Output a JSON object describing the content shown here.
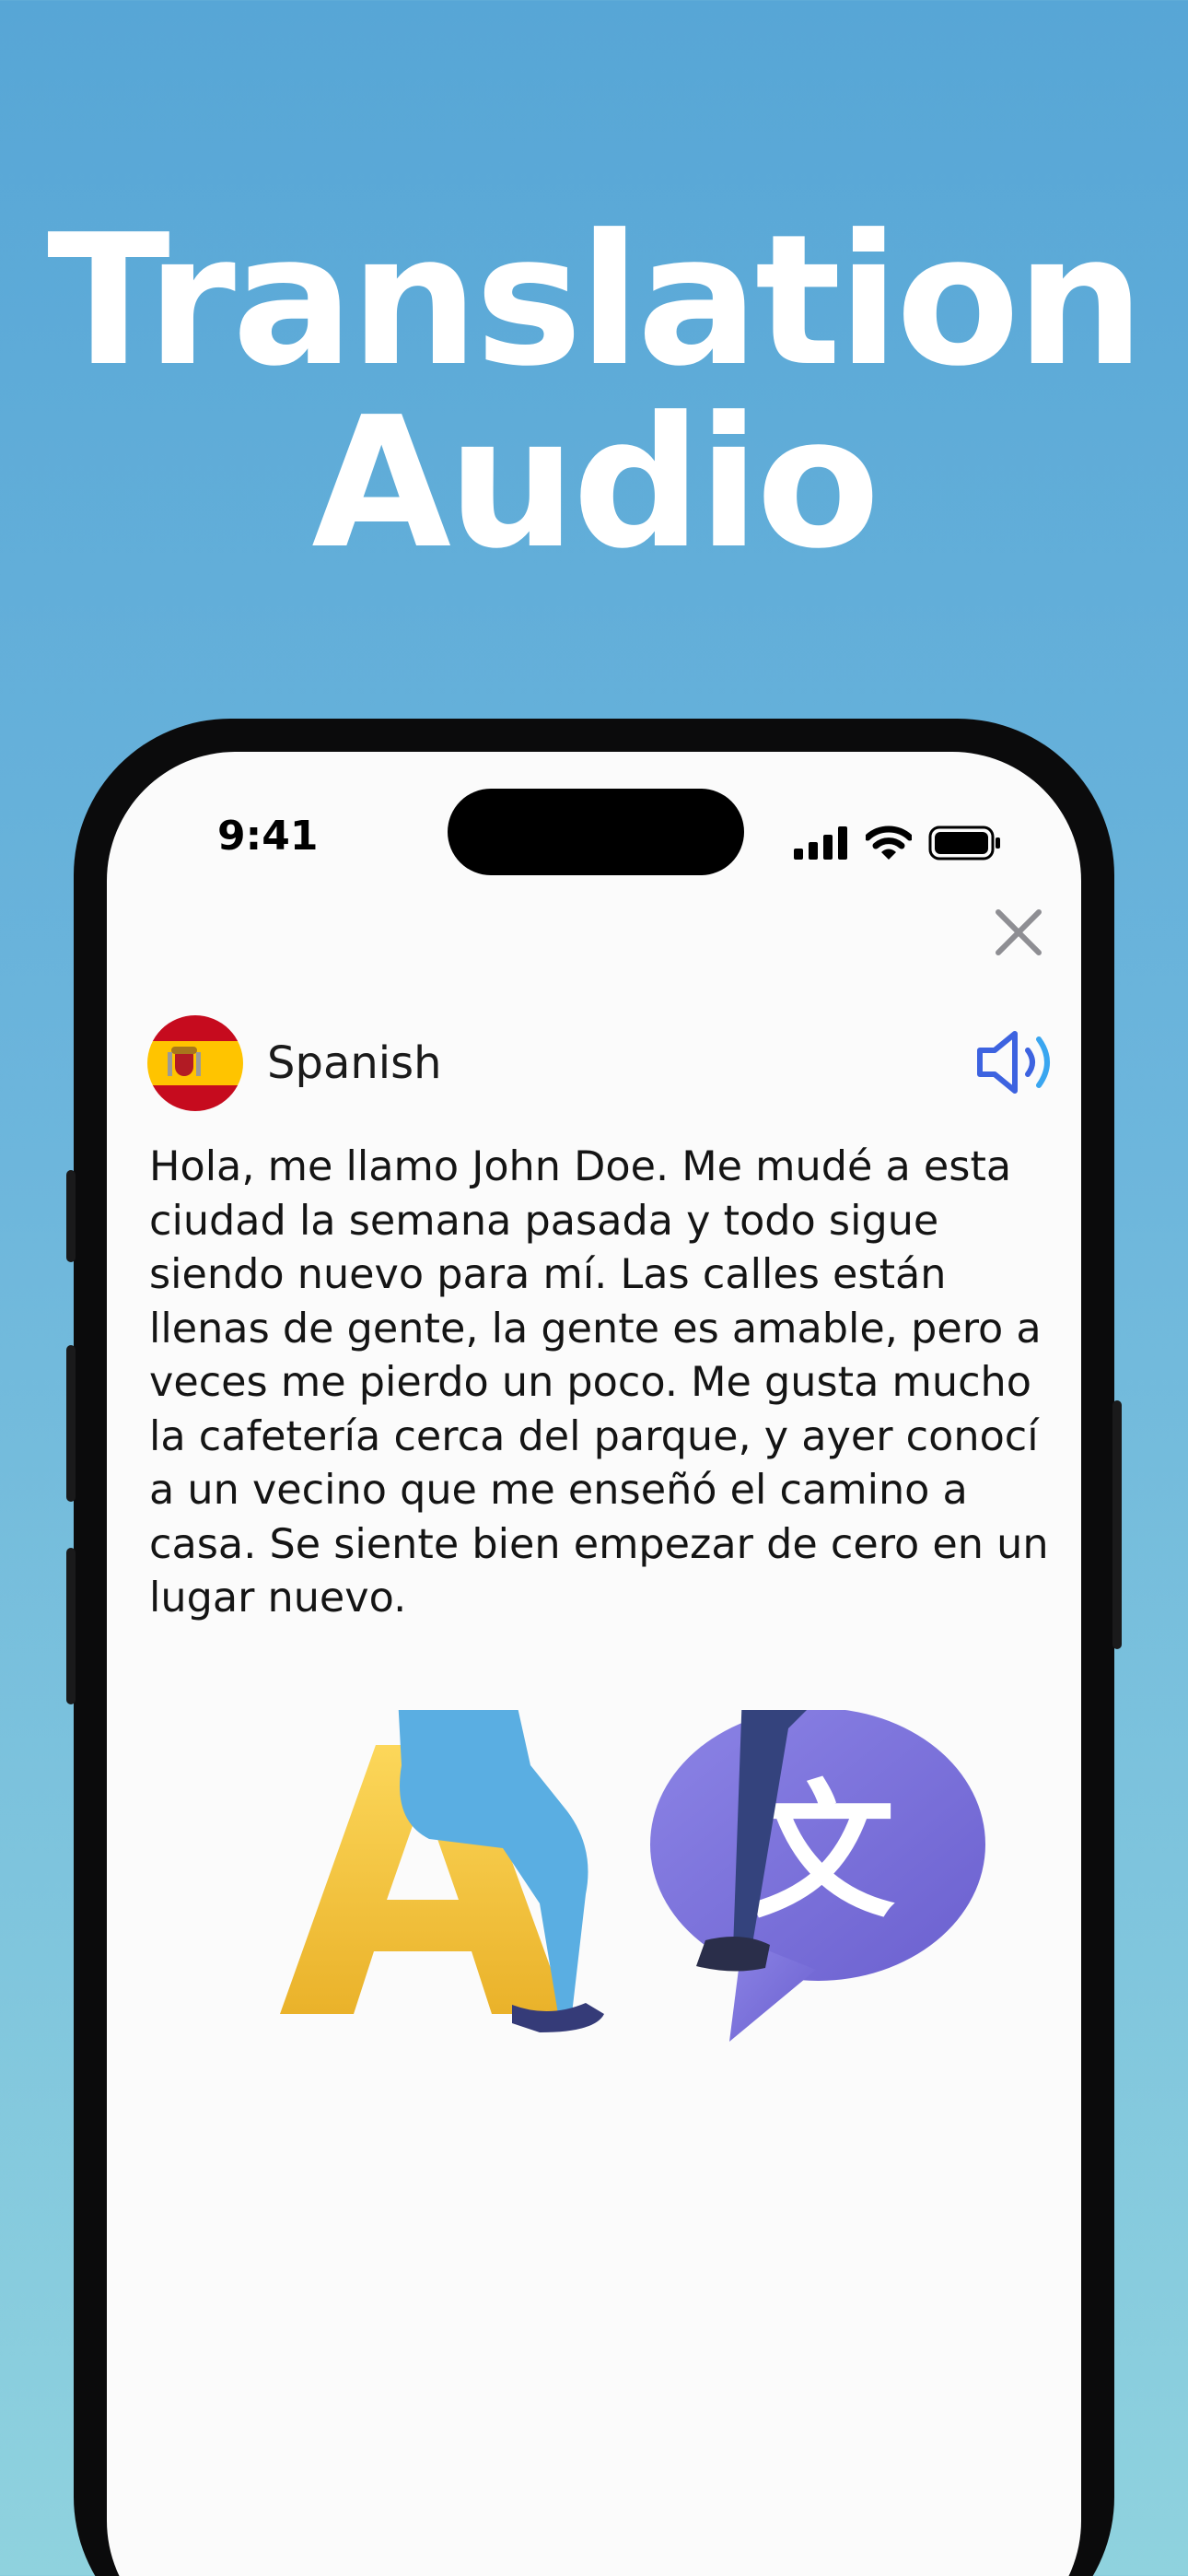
{
  "headline": {
    "line1": "Translation",
    "line2": "Audio"
  },
  "status_bar": {
    "time": "9:41"
  },
  "language": {
    "name": "Spanish",
    "flag": "spain-flag"
  },
  "content": {
    "text": "Hola, me llamo John Doe. Me mudé a esta ciudad la semana pasada y todo sigue siendo nuevo para mí. Las calles están llenas de gente, la gente es amable, pero a veces me pierdo un poco. Me gusta mucho la cafetería cerca del parque, y ayer conocí a un vecino que me enseñó el camino a casa. Se siente bien empezar de cero en un lugar nuevo."
  },
  "illustration": {
    "letter": "A",
    "glyph": "文"
  },
  "icons": {
    "close": "close-icon",
    "speaker": "speaker-icon",
    "signal": "signal-icon",
    "wifi": "wifi-icon",
    "battery": "battery-icon"
  },
  "colors": {
    "background_top": "#57a6d6",
    "background_bottom": "#8fd2de",
    "accent": "#3d63e0",
    "letter_yellow": "#f6c63c",
    "bubble_purple": "#7e73da"
  }
}
